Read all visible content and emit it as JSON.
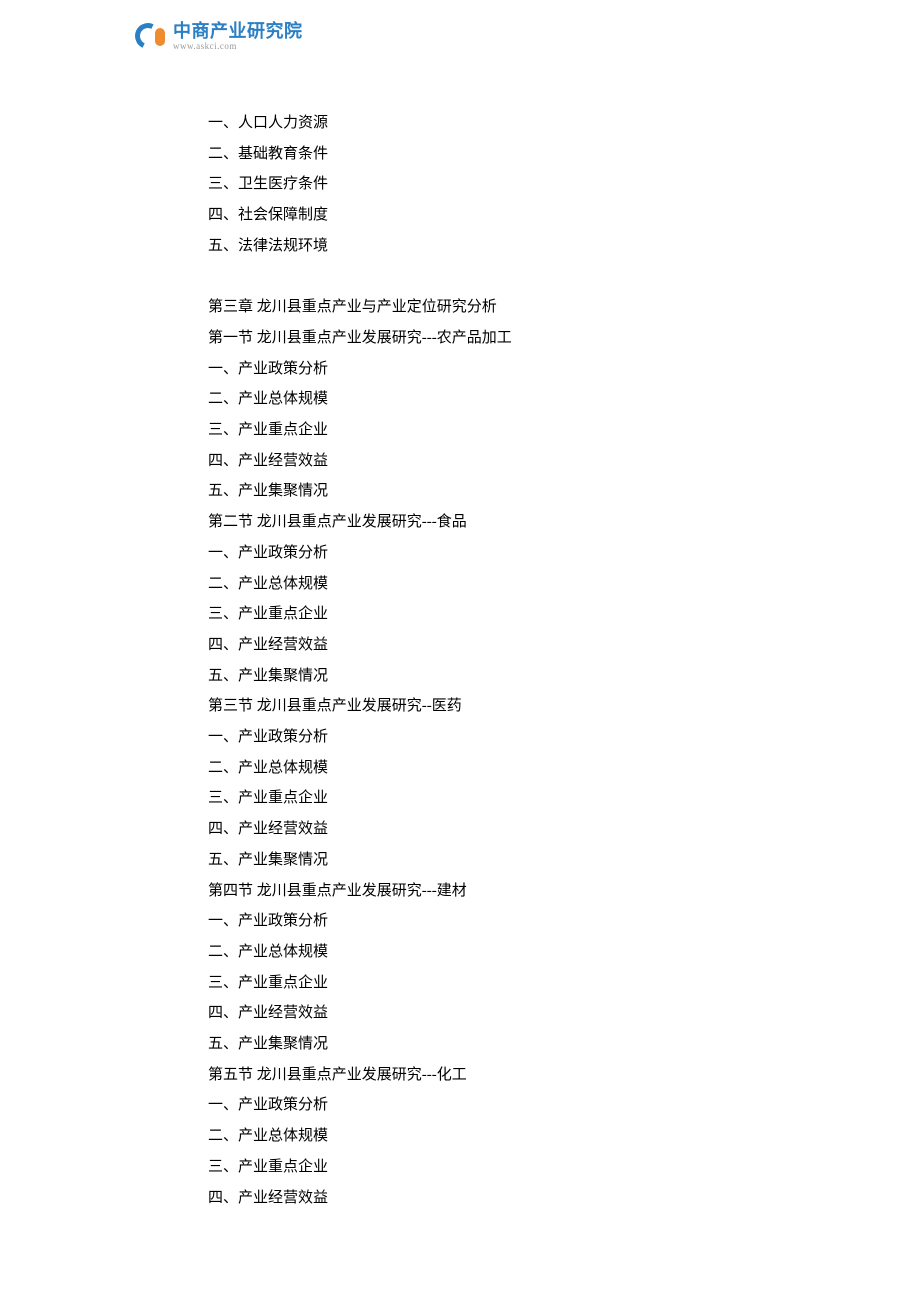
{
  "logo": {
    "cn": "中商产业研究院",
    "en": "www.askci.com"
  },
  "toc": [
    "一、人口人力资源",
    "二、基础教育条件",
    "三、卫生医疗条件",
    "四、社会保障制度",
    "五、法律法规环境",
    "",
    "第三章 龙川县重点产业与产业定位研究分析",
    "第一节 龙川县重点产业发展研究---农产品加工",
    "一、产业政策分析",
    "二、产业总体规模",
    "三、产业重点企业",
    "四、产业经营效益",
    "五、产业集聚情况",
    "第二节 龙川县重点产业发展研究---食品",
    "一、产业政策分析",
    "二、产业总体规模",
    "三、产业重点企业",
    "四、产业经营效益",
    "五、产业集聚情况",
    "第三节 龙川县重点产业发展研究--医药",
    "一、产业政策分析",
    "二、产业总体规模",
    "三、产业重点企业",
    "四、产业经营效益",
    "五、产业集聚情况",
    "第四节 龙川县重点产业发展研究---建材",
    "一、产业政策分析",
    "二、产业总体规模",
    "三、产业重点企业",
    "四、产业经营效益",
    "五、产业集聚情况",
    "第五节 龙川县重点产业发展研究---化工",
    "一、产业政策分析",
    "二、产业总体规模",
    "三、产业重点企业",
    "四、产业经营效益"
  ]
}
